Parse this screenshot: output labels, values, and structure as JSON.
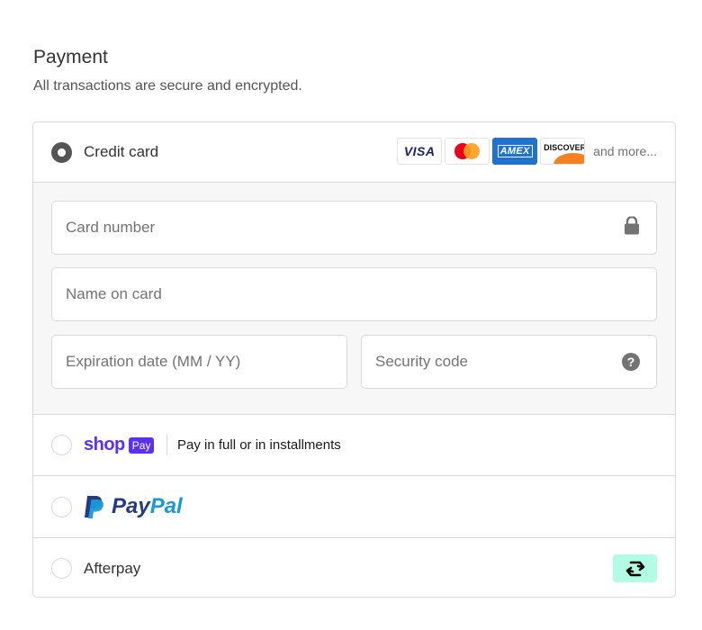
{
  "header": {
    "title": "Payment",
    "subtitle": "All transactions are secure and encrypted."
  },
  "methods": {
    "credit_card": {
      "label": "Credit card",
      "selected": true,
      "card_logos": [
        "VISA",
        "AMEX",
        "DISCOVER"
      ],
      "and_more": "and more...",
      "fields": {
        "card_number_placeholder": "Card number",
        "name_placeholder": "Name on card",
        "expiration_placeholder": "Expiration date (MM / YY)",
        "security_placeholder": "Security code",
        "security_help_glyph": "?"
      }
    },
    "shop_pay": {
      "logo_word": "shop",
      "logo_badge": "Pay",
      "tagline": "Pay in full or in installments",
      "selected": false
    },
    "paypal": {
      "word_dark": "Pay",
      "word_light": "Pal",
      "selected": false
    },
    "afterpay": {
      "label": "Afterpay",
      "selected": false
    }
  },
  "colors": {
    "shop_pay_purple": "#5a31f4",
    "paypal_dark": "#253b80",
    "paypal_light": "#179bd7",
    "afterpay_mint": "#b2fce4",
    "radio_selected": "#555555"
  },
  "icons": {
    "card_number": "lock-icon",
    "security_code": "help-icon",
    "afterpay": "afterpay-logo-icon"
  }
}
